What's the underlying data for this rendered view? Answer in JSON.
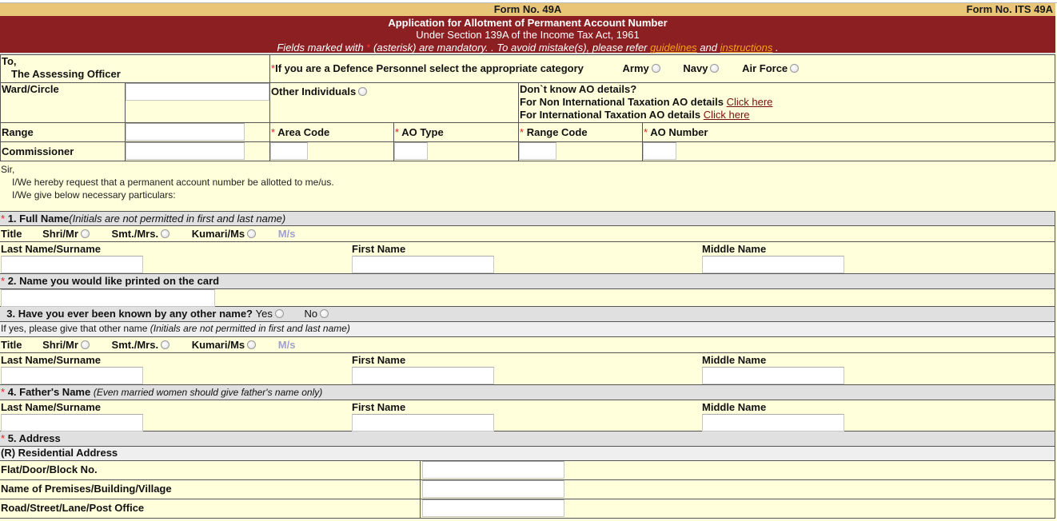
{
  "header": {
    "form_no_center": "Form No. 49A",
    "form_no_right": "Form No. ITS 49A",
    "title": "Application for Allotment of Permanent Account Number",
    "subtitle": "Under Section 139A of the Income Tax Act, 1961",
    "note_prefix": "Fields marked with",
    "note_star": "*",
    "note_middle": "(asterisk) are mandatory. . To avoid mistake(s), please refer",
    "guidelines_link": "guidelines",
    "and_text": "and",
    "instructions_link": "instructions",
    "note_end": "."
  },
  "ao": {
    "to_label": "To,",
    "officer_label": "The Assessing Officer",
    "defence_star": "*",
    "defence_prompt": "If you are a Defence Personnel select the appropriate category",
    "defence_options": [
      "Army",
      "Navy",
      "Air Force"
    ],
    "ward_label": "Ward/Circle",
    "other_individuals": "Other Individuals",
    "dont_know": "Don`t know AO details?",
    "non_intl_text": "For Non International Taxation AO details",
    "intl_text": "For International Taxation AO details",
    "click_here": "Click here",
    "range_label": "Range",
    "commissioner_label": "Commissioner",
    "area_code": "Area Code",
    "ao_type": "AO Type",
    "range_code": "Range Code",
    "ao_number": "AO Number",
    "req_star": "*"
  },
  "intro": {
    "sir": "Sir,",
    "line1": "I/We hereby request that a permanent account number be allotted to me/us.",
    "line2": "I/We give below necessary particulars:"
  },
  "sections": {
    "s1_title": "1. Full Name",
    "s1_note": "(Initials are not permitted in first and last name)",
    "title_label": "Title",
    "title_options": [
      "Shri/Mr",
      "Smt./Mrs.",
      "Kumari/Ms"
    ],
    "ms_label": "M/s",
    "last_name": "Last Name/Surname",
    "first_name": "First Name",
    "middle_name": "Middle Name",
    "s2_title": "2. Name you would like printed on the card",
    "s3_title": "3. Have you ever been known by any other name?",
    "yes": "Yes",
    "no": "No",
    "s3_sub": "If yes, please give that other name",
    "s4_title": "4. Father's Name",
    "s4_note": "(Even married women should give father's name only)",
    "s5_title": "5. Address",
    "residential": "(R) Residential Address",
    "address_fields": [
      "Flat/Door/Block No.",
      "Name of Premises/Building/Village",
      "Road/Street/Lane/Post Office"
    ]
  },
  "colors": {
    "banner": "#8b1f22",
    "form_bar": "#e8c577",
    "form_bg": "#ffffdc",
    "section_bg": "#e0e0e0",
    "link_orange": "#f6a11a"
  }
}
